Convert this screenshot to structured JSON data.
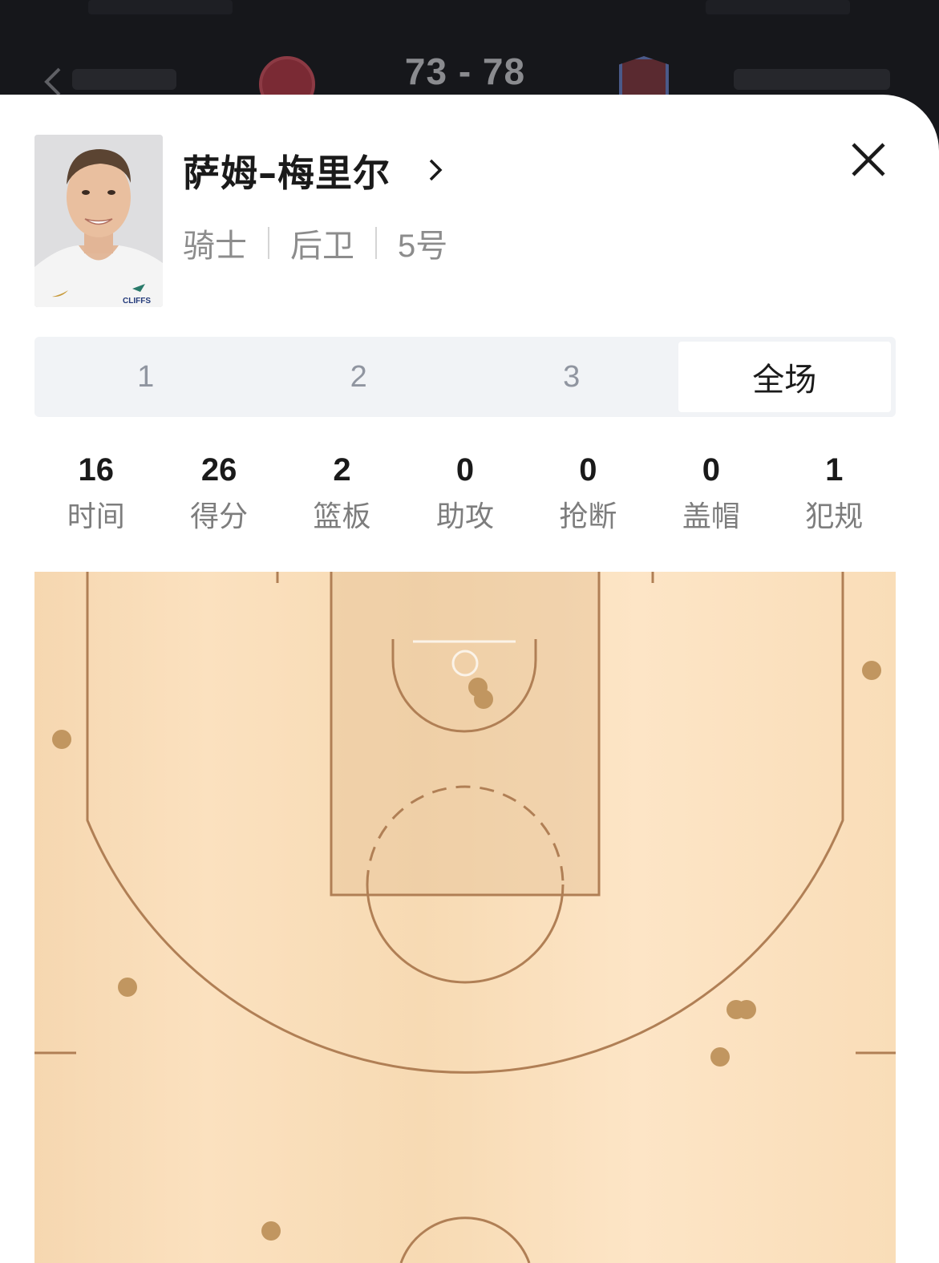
{
  "header": {
    "score": "73 - 78"
  },
  "player": {
    "name": "萨姆–梅里尔",
    "team": "骑士",
    "position": "后卫",
    "number": "5号",
    "jersey_sponsor": "CLIFFS"
  },
  "periods": {
    "tabs": [
      "1",
      "2",
      "3",
      "全场"
    ],
    "selected": "全场"
  },
  "stats": [
    {
      "value": "16",
      "label": "时间"
    },
    {
      "value": "26",
      "label": "得分"
    },
    {
      "value": "2",
      "label": "篮板"
    },
    {
      "value": "0",
      "label": "助攻"
    },
    {
      "value": "0",
      "label": "抢断"
    },
    {
      "value": "0",
      "label": "盖帽"
    },
    {
      "value": "1",
      "label": "犯规"
    }
  ],
  "colors": {
    "court_line": "#b07f55",
    "shot_marker": "#c19660",
    "tab_bg": "#f1f3f6"
  }
}
